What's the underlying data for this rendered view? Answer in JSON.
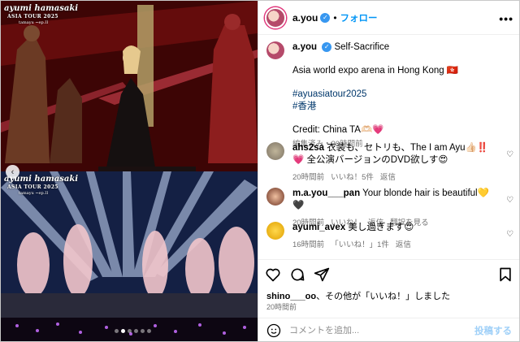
{
  "media": {
    "overlay_title": "ayumi hamasaki",
    "overlay_sub": "ASIA TOUR 2025",
    "overlay_sub2": "tamayu ~ep.II",
    "carousel": {
      "count": 6,
      "active": 1
    }
  },
  "header": {
    "username": "a.you",
    "separator": "•",
    "follow_label": "フォロー",
    "more_label": "•••"
  },
  "caption": {
    "username": "a.you",
    "title": "Self-Sacrifice",
    "line1": "Asia world expo arena in Hong Kong 🇭🇰",
    "hashtag1": "#ayuasiatour2025",
    "hashtag2": "#香港",
    "credit": "Credit: China TA🫶🏻💗",
    "meta": "編集済み・20時間前"
  },
  "comments": [
    {
      "username": "ahs2sa",
      "text": "衣装も、セトリも、The I am Ayu👍🏻‼️💗 全公演バージョンのDVD欲しす😍",
      "time": "20時間前",
      "likes": "いいね！5件",
      "reply": "返信"
    },
    {
      "username": "m.a.you___pan",
      "text": "Your blonde hair is beautiful💛🖤",
      "time": "20時間前",
      "likes": "いいね！",
      "reply": "返信",
      "translate": "翻訳を見る"
    },
    {
      "username": "ayumi_avex",
      "text": "美し過ぎます😍",
      "time": "16時間前",
      "likes": "「いいね！」1件",
      "reply": "返信"
    }
  ],
  "actions": {
    "liked_by_user": "shino___oo",
    "liked_by_rest": "、その他が「いいね！」しました",
    "time": "20時間前"
  },
  "comment_input": {
    "placeholder": "コメントを追加...",
    "post_label": "投稿する"
  },
  "colors": {
    "accent": "#0095f6",
    "verified": "#3797f0",
    "muted": "#737373"
  }
}
